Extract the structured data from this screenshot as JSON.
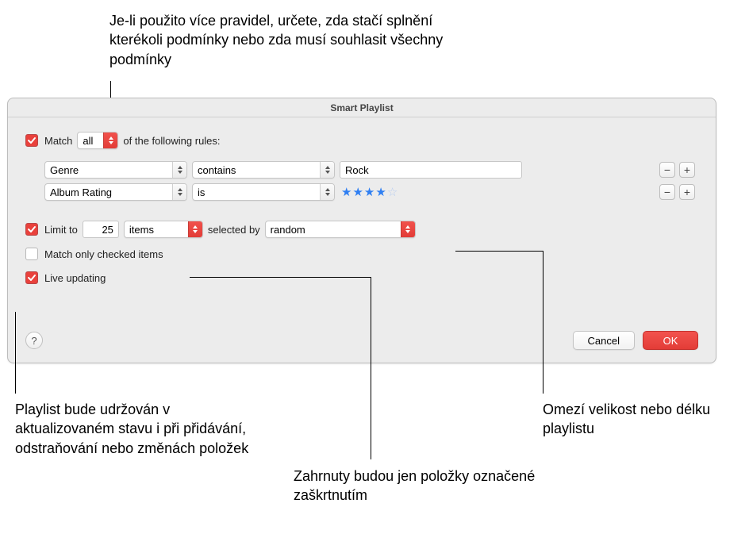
{
  "callouts": {
    "top": "Je-li použito více pravidel, určete, zda stačí splnění kterékoli podmínky nebo zda musí souhlasit všechny podmínky",
    "right": "Omezí velikost nebo délku playlistu",
    "mid": "Zahrnuty budou jen položky označené zaškrtnutím",
    "left": "Playlist bude udržován v aktualizovaném stavu i při přidávání, odstraňování nebo změnách položek"
  },
  "dialog": {
    "title": "Smart Playlist",
    "match_label_pre": "Match",
    "match_mode": "all",
    "match_label_post": "of the following rules:",
    "rules": [
      {
        "field": "Genre",
        "op": "contains",
        "value": "Rock",
        "stars": null
      },
      {
        "field": "Album Rating",
        "op": "is",
        "value": "",
        "stars": 4
      }
    ],
    "limit": {
      "checkbox_label": "Limit to",
      "value": "25",
      "unit": "items",
      "selected_by_label": "selected by",
      "selected_by": "random"
    },
    "match_checked_label": "Match only checked items",
    "live_label": "Live updating",
    "help_glyph": "?",
    "cancel": "Cancel",
    "ok": "OK",
    "minus": "−",
    "plus": "+"
  }
}
